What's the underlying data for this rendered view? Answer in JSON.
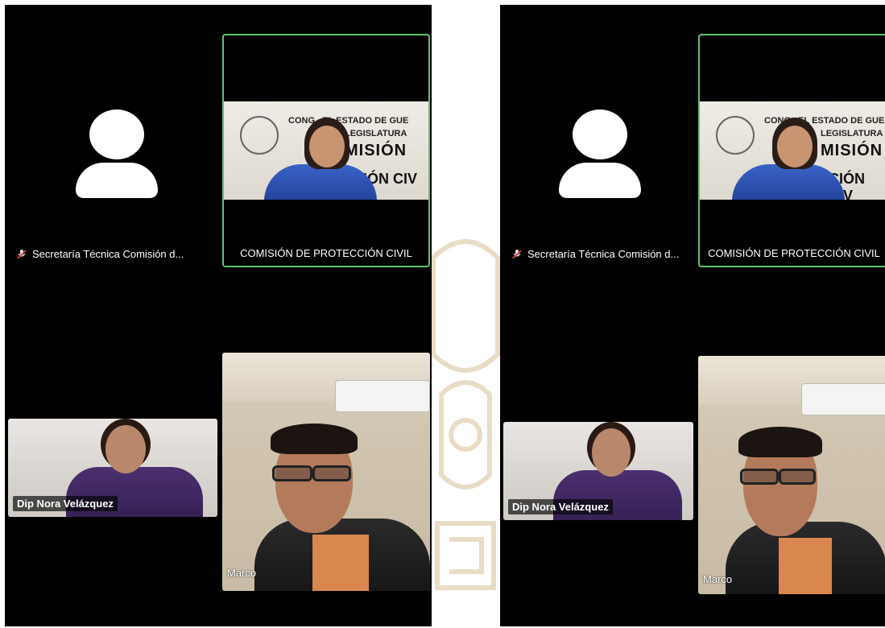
{
  "participants": {
    "secretaria": {
      "name": "Secretaría Técnica Comisión d...",
      "muted_icon": "mic-off-icon"
    },
    "comision": {
      "name": "COMISIÓN DE PROTECCIÓN CIVIL",
      "banner_line1": "CONG...EL ESTADO DE GUE",
      "banner_line1b": "LEGISLATURA",
      "banner_line2": "MISIÓN",
      "banner_line3": "CIÓN CIV"
    },
    "nora": {
      "name": "Dip Nora Velázquez"
    },
    "marco": {
      "name": "Marco"
    }
  },
  "colors": {
    "active_speaker_border": "#5fc46f",
    "background": "#000000"
  }
}
